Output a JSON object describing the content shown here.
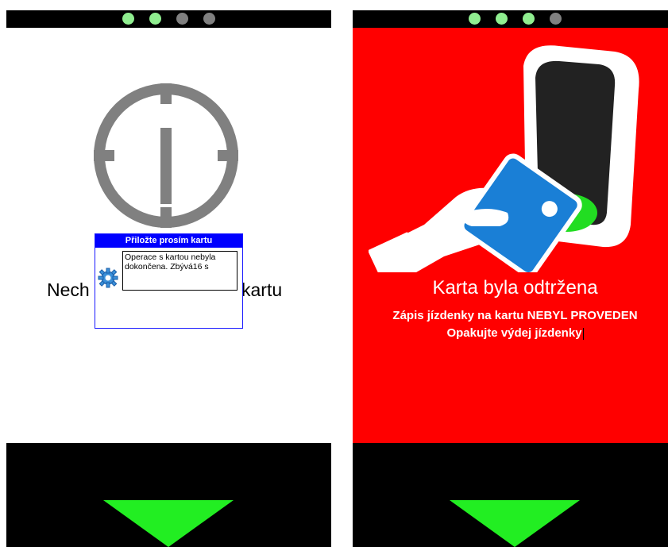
{
  "left_panel": {
    "status_dots": [
      "#90ee90",
      "#90ee90",
      "#808080",
      "#808080"
    ],
    "icon": "clock-icon",
    "main_text_left": "Nech",
    "main_text_right": "kartu",
    "dialog": {
      "title": "Přiložte prosím kartu",
      "message": "Operace s kartou nebyla dokončena. Zbývá16 s",
      "icon": "gear-icon"
    },
    "arrow_color": "#22ee22"
  },
  "right_panel": {
    "status_dots": [
      "#90ee90",
      "#90ee90",
      "#90ee90",
      "#808080"
    ],
    "background": "#ff0000",
    "illustration": "card-reader-hand-icon",
    "headline": "Karta byla odtržena",
    "line1": "Zápis jízdenky na kartu NEBYL PROVEDEN",
    "line2": "Opakujte výdej jízdenky",
    "arrow_color": "#22ee22"
  }
}
